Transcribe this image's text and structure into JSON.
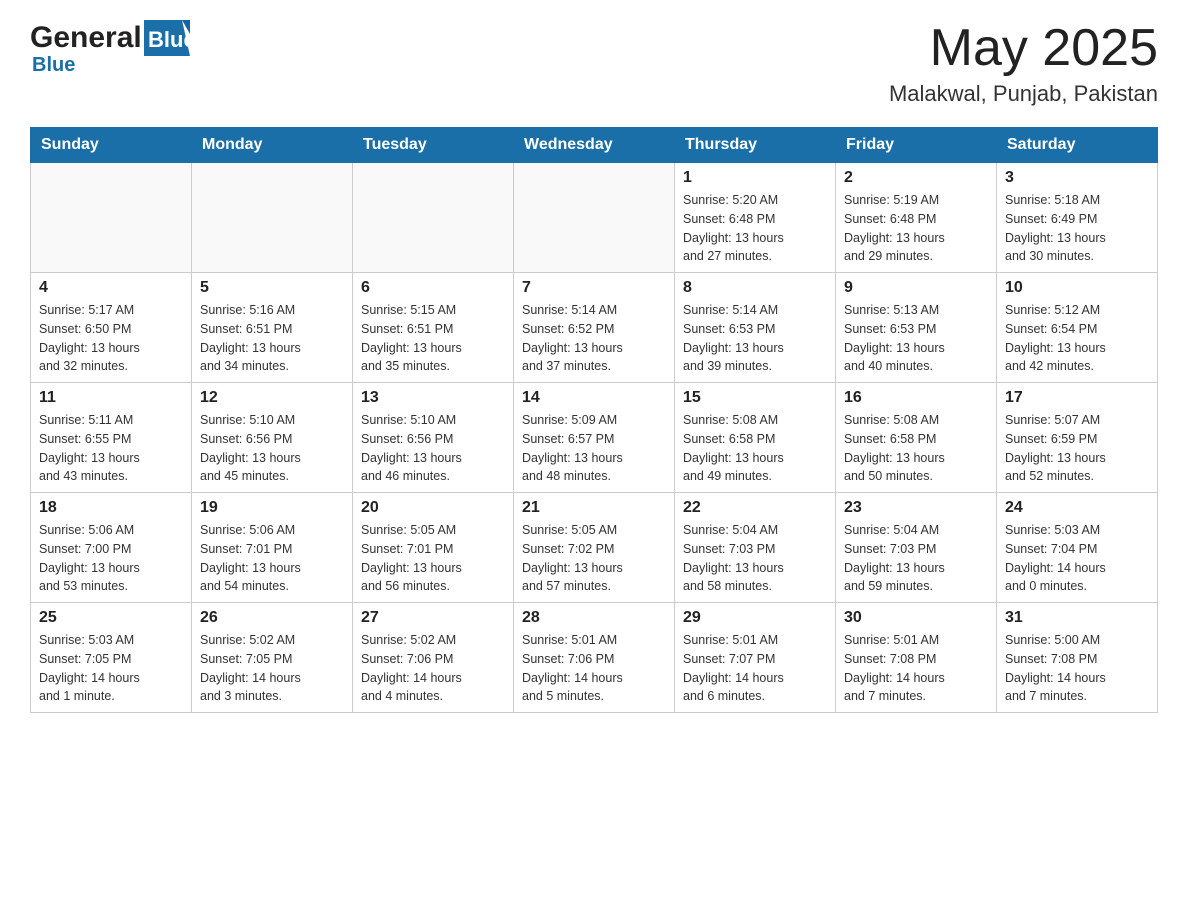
{
  "header": {
    "logo": {
      "general": "General",
      "blue": "Blue"
    },
    "title": "May 2025",
    "location": "Malakwal, Punjab, Pakistan"
  },
  "weekdays": [
    "Sunday",
    "Monday",
    "Tuesday",
    "Wednesday",
    "Thursday",
    "Friday",
    "Saturday"
  ],
  "weeks": [
    [
      {
        "day": "",
        "info": ""
      },
      {
        "day": "",
        "info": ""
      },
      {
        "day": "",
        "info": ""
      },
      {
        "day": "",
        "info": ""
      },
      {
        "day": "1",
        "info": "Sunrise: 5:20 AM\nSunset: 6:48 PM\nDaylight: 13 hours\nand 27 minutes."
      },
      {
        "day": "2",
        "info": "Sunrise: 5:19 AM\nSunset: 6:48 PM\nDaylight: 13 hours\nand 29 minutes."
      },
      {
        "day": "3",
        "info": "Sunrise: 5:18 AM\nSunset: 6:49 PM\nDaylight: 13 hours\nand 30 minutes."
      }
    ],
    [
      {
        "day": "4",
        "info": "Sunrise: 5:17 AM\nSunset: 6:50 PM\nDaylight: 13 hours\nand 32 minutes."
      },
      {
        "day": "5",
        "info": "Sunrise: 5:16 AM\nSunset: 6:51 PM\nDaylight: 13 hours\nand 34 minutes."
      },
      {
        "day": "6",
        "info": "Sunrise: 5:15 AM\nSunset: 6:51 PM\nDaylight: 13 hours\nand 35 minutes."
      },
      {
        "day": "7",
        "info": "Sunrise: 5:14 AM\nSunset: 6:52 PM\nDaylight: 13 hours\nand 37 minutes."
      },
      {
        "day": "8",
        "info": "Sunrise: 5:14 AM\nSunset: 6:53 PM\nDaylight: 13 hours\nand 39 minutes."
      },
      {
        "day": "9",
        "info": "Sunrise: 5:13 AM\nSunset: 6:53 PM\nDaylight: 13 hours\nand 40 minutes."
      },
      {
        "day": "10",
        "info": "Sunrise: 5:12 AM\nSunset: 6:54 PM\nDaylight: 13 hours\nand 42 minutes."
      }
    ],
    [
      {
        "day": "11",
        "info": "Sunrise: 5:11 AM\nSunset: 6:55 PM\nDaylight: 13 hours\nand 43 minutes."
      },
      {
        "day": "12",
        "info": "Sunrise: 5:10 AM\nSunset: 6:56 PM\nDaylight: 13 hours\nand 45 minutes."
      },
      {
        "day": "13",
        "info": "Sunrise: 5:10 AM\nSunset: 6:56 PM\nDaylight: 13 hours\nand 46 minutes."
      },
      {
        "day": "14",
        "info": "Sunrise: 5:09 AM\nSunset: 6:57 PM\nDaylight: 13 hours\nand 48 minutes."
      },
      {
        "day": "15",
        "info": "Sunrise: 5:08 AM\nSunset: 6:58 PM\nDaylight: 13 hours\nand 49 minutes."
      },
      {
        "day": "16",
        "info": "Sunrise: 5:08 AM\nSunset: 6:58 PM\nDaylight: 13 hours\nand 50 minutes."
      },
      {
        "day": "17",
        "info": "Sunrise: 5:07 AM\nSunset: 6:59 PM\nDaylight: 13 hours\nand 52 minutes."
      }
    ],
    [
      {
        "day": "18",
        "info": "Sunrise: 5:06 AM\nSunset: 7:00 PM\nDaylight: 13 hours\nand 53 minutes."
      },
      {
        "day": "19",
        "info": "Sunrise: 5:06 AM\nSunset: 7:01 PM\nDaylight: 13 hours\nand 54 minutes."
      },
      {
        "day": "20",
        "info": "Sunrise: 5:05 AM\nSunset: 7:01 PM\nDaylight: 13 hours\nand 56 minutes."
      },
      {
        "day": "21",
        "info": "Sunrise: 5:05 AM\nSunset: 7:02 PM\nDaylight: 13 hours\nand 57 minutes."
      },
      {
        "day": "22",
        "info": "Sunrise: 5:04 AM\nSunset: 7:03 PM\nDaylight: 13 hours\nand 58 minutes."
      },
      {
        "day": "23",
        "info": "Sunrise: 5:04 AM\nSunset: 7:03 PM\nDaylight: 13 hours\nand 59 minutes."
      },
      {
        "day": "24",
        "info": "Sunrise: 5:03 AM\nSunset: 7:04 PM\nDaylight: 14 hours\nand 0 minutes."
      }
    ],
    [
      {
        "day": "25",
        "info": "Sunrise: 5:03 AM\nSunset: 7:05 PM\nDaylight: 14 hours\nand 1 minute."
      },
      {
        "day": "26",
        "info": "Sunrise: 5:02 AM\nSunset: 7:05 PM\nDaylight: 14 hours\nand 3 minutes."
      },
      {
        "day": "27",
        "info": "Sunrise: 5:02 AM\nSunset: 7:06 PM\nDaylight: 14 hours\nand 4 minutes."
      },
      {
        "day": "28",
        "info": "Sunrise: 5:01 AM\nSunset: 7:06 PM\nDaylight: 14 hours\nand 5 minutes."
      },
      {
        "day": "29",
        "info": "Sunrise: 5:01 AM\nSunset: 7:07 PM\nDaylight: 14 hours\nand 6 minutes."
      },
      {
        "day": "30",
        "info": "Sunrise: 5:01 AM\nSunset: 7:08 PM\nDaylight: 14 hours\nand 7 minutes."
      },
      {
        "day": "31",
        "info": "Sunrise: 5:00 AM\nSunset: 7:08 PM\nDaylight: 14 hours\nand 7 minutes."
      }
    ]
  ]
}
